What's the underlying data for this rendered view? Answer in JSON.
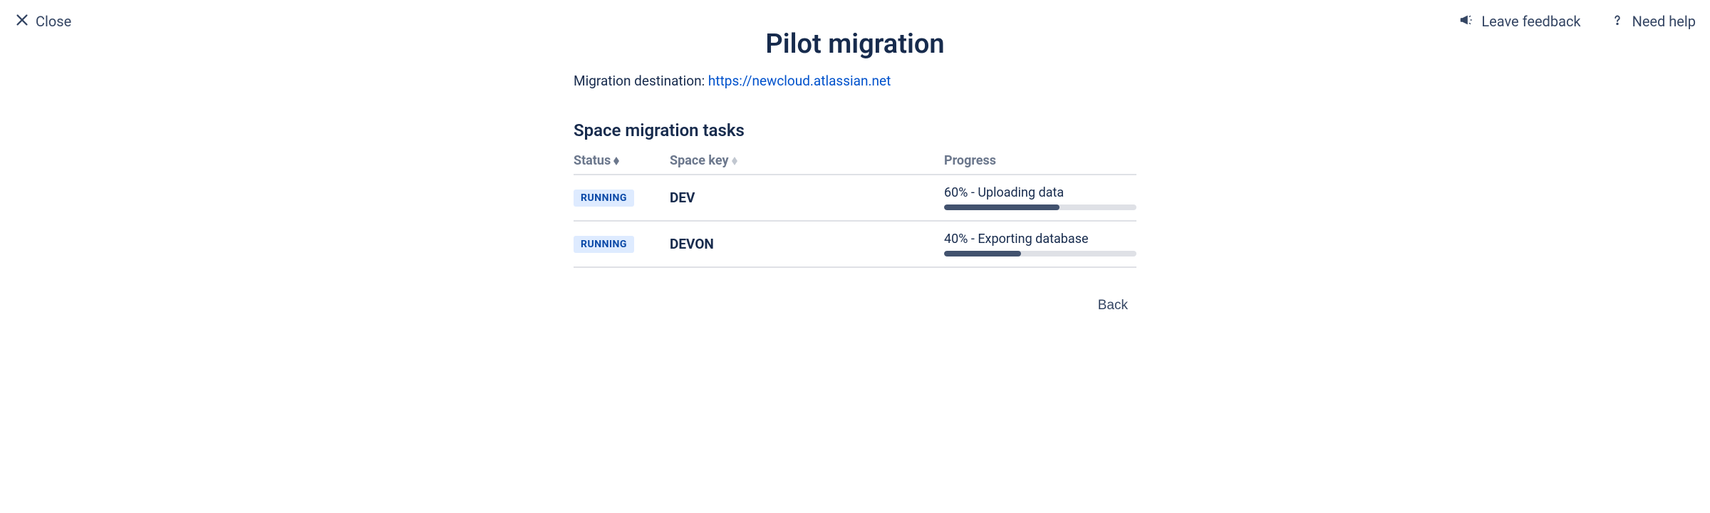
{
  "topbar": {
    "close_label": "Close",
    "feedback_label": "Leave feedback",
    "help_label": "Need help"
  },
  "page": {
    "title": "Pilot migration",
    "destination_label": "Migration destination: ",
    "destination_url": "https://newcloud.atlassian.net"
  },
  "tasks": {
    "section_title": "Space migration tasks",
    "columns": {
      "status": "Status",
      "space_key": "Space key",
      "progress": "Progress"
    },
    "rows": [
      {
        "status": "RUNNING",
        "space_key": "DEV",
        "progress_pct": 60,
        "progress_text": "60% - Uploading data"
      },
      {
        "status": "RUNNING",
        "space_key": "DEVON",
        "progress_pct": 40,
        "progress_text": "40% - Exporting database"
      }
    ]
  },
  "footer": {
    "back_label": "Back"
  },
  "colors": {
    "text_primary": "#172b4d",
    "text_muted": "#6b778c",
    "link": "#0052cc",
    "badge_bg": "#deebff",
    "badge_text": "#0747a6",
    "bar_bg": "#dfe1e6",
    "bar_fill": "#42526e"
  }
}
